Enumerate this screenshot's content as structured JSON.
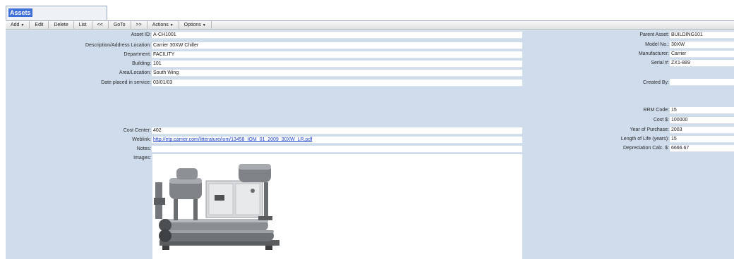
{
  "window": {
    "title": "Assets"
  },
  "toolbar": {
    "items": [
      {
        "label": "Add",
        "caret": "▼"
      },
      {
        "label": "Edit",
        "caret": ""
      },
      {
        "label": "Delete",
        "caret": ""
      },
      {
        "label": "List",
        "caret": ""
      },
      {
        "label": "<<",
        "caret": ""
      },
      {
        "label": "GoTo",
        "caret": ""
      },
      {
        "label": ">>",
        "caret": ""
      },
      {
        "label": "Actions",
        "caret": "▼"
      },
      {
        "label": "Options",
        "caret": "▼"
      }
    ]
  },
  "left": {
    "asset_id": {
      "label": "Asset ID:",
      "value": "A-CH1001"
    },
    "description": {
      "label": "Description/Address Location:",
      "value": "Carrier 30XW Chiller"
    },
    "department": {
      "label": "Department:",
      "value": "FACILITY"
    },
    "building": {
      "label": "Building:",
      "value": "101"
    },
    "area": {
      "label": "Area/Location:",
      "value": "South Wing"
    },
    "date_placed": {
      "label": "Date placed in service:",
      "value": "03/01/03"
    },
    "cost_center": {
      "label": "Cost Center:",
      "value": "402"
    },
    "weblink": {
      "label": "Weblink:",
      "value": "http://etp.carrier.com/litterature/iom/13458_IOM_01_2009_30XW_LR.pdf"
    },
    "notes": {
      "label": "Notes:",
      "value": ""
    },
    "images": {
      "label": "Images:"
    }
  },
  "right": {
    "parent_asset": {
      "label": "Parent Asset:",
      "value": "BUILDING101"
    },
    "model_no": {
      "label": "Model No.:",
      "value": "30XW"
    },
    "manufacturer": {
      "label": "Manufacturer:",
      "value": "Carrier"
    },
    "serial": {
      "label": "Serial #:",
      "value": "ZX1-889"
    },
    "created_by": {
      "label": "Created By:",
      "value": ""
    },
    "rrm_code": {
      "label": "RRM Code:",
      "value": "15"
    },
    "cost": {
      "label": "Cost $:",
      "value": "100000"
    },
    "year_of_purchase": {
      "label": "Year of Purchase:",
      "value": "2003"
    },
    "length_of_life": {
      "label": "Length of Life (years):",
      "value": "15"
    },
    "depreciation": {
      "label": "Depreciation Calc. $:",
      "value": "6666.67"
    }
  }
}
